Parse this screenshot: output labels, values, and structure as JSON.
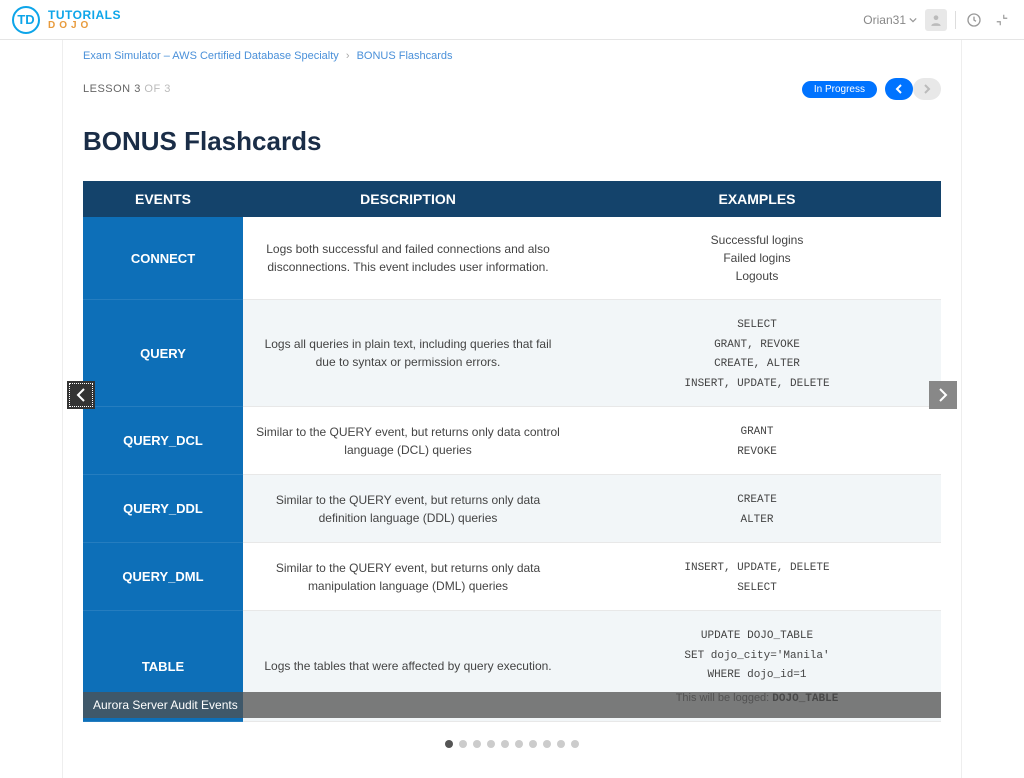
{
  "header": {
    "logo_initials": "TD",
    "logo_top": "TUTORIALS",
    "logo_bottom": "DOJO",
    "username": "Orian31"
  },
  "breadcrumb": {
    "item1": "Exam Simulator – AWS Certified Database Specialty",
    "sep": "›",
    "item2": "BONUS Flashcards"
  },
  "lesson": {
    "label": "LESSON",
    "current": "3",
    "of_label": "OF",
    "total": "3",
    "status": "In Progress"
  },
  "title": "BONUS Flashcards",
  "table": {
    "headers": [
      "EVENTS",
      "DESCRIPTION",
      "EXAMPLES"
    ],
    "rows": [
      {
        "event": "CONNECT",
        "desc": "Logs both successful and failed connections and also disconnections. This event includes user information.",
        "examples_text": "Successful logins\nFailed logins\nLogouts",
        "mono": false
      },
      {
        "event": "QUERY",
        "desc": "Logs all queries in plain text, including queries that fail due to syntax or permission errors.",
        "examples_text": "SELECT\nGRANT, REVOKE\nCREATE, ALTER\nINSERT, UPDATE, DELETE",
        "mono": true
      },
      {
        "event": "QUERY_DCL",
        "desc": "Similar to the QUERY event, but returns only data control language (DCL) queries",
        "examples_text": "GRANT\nREVOKE",
        "mono": true
      },
      {
        "event": "QUERY_DDL",
        "desc": "Similar to the QUERY event, but returns only data definition language (DDL) queries",
        "examples_text": "CREATE\nALTER",
        "mono": true
      },
      {
        "event": "QUERY_DML",
        "desc": "Similar to the QUERY event, but returns only data manipulation language (DML) queries",
        "examples_text": "INSERT, UPDATE, DELETE\nSELECT",
        "mono": true
      },
      {
        "event": "TABLE",
        "desc": "Logs the tables that were affected by query execution.",
        "examples_text": "UPDATE DOJO_TABLE\nSET dojo_city='Manila'\nWHERE dojo_id=1",
        "mono": true,
        "note_prefix": "This will be logged: ",
        "note_bold": "DOJO_TABLE"
      }
    ]
  },
  "caption": "Aurora Server Audit Events",
  "dots": {
    "count": 10,
    "active": 0
  }
}
